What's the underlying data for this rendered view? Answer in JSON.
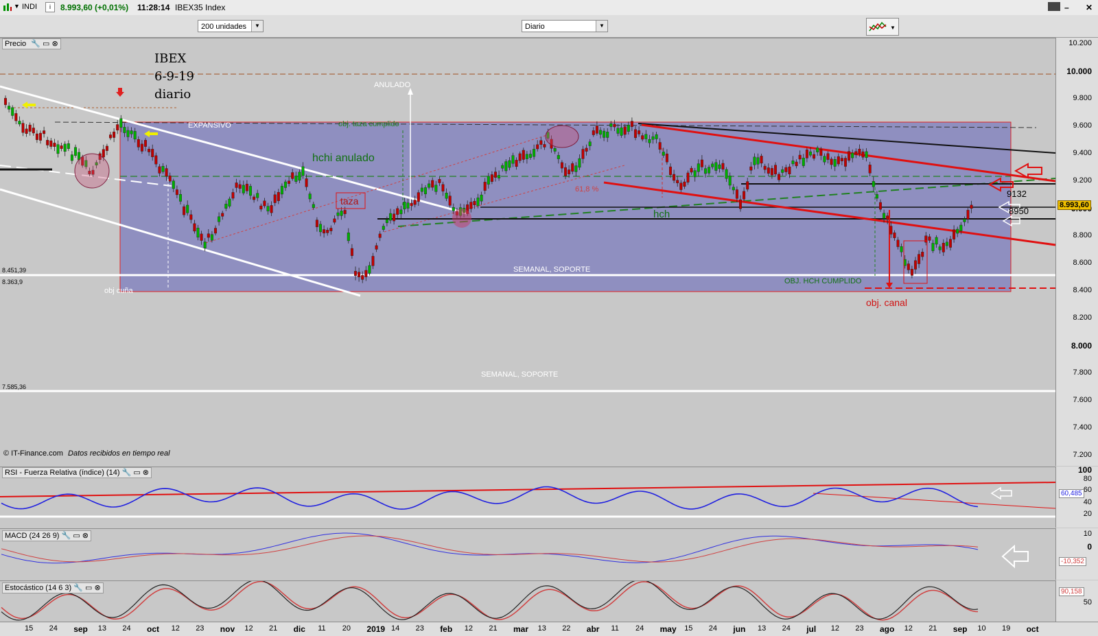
{
  "header": {
    "instrument": "INDI",
    "price": "8.993,60 (+0,01%)",
    "time": "11:28:14",
    "index_name": "IBEX35 Index"
  },
  "toolbar": {
    "units_value": "200 unidades",
    "period_value": "Diario"
  },
  "price_panel": {
    "title": "Precio",
    "chart_title": [
      "IBEX",
      "6-9-19",
      "diario"
    ],
    "annotations": {
      "expansivo": "EXPANSIVO",
      "anulado": "ANULADO",
      "obj_taza": "obj. taza cumplido",
      "hchi_anulado": "hchi anulado",
      "taza": "taza",
      "pct": "61,8 %",
      "hch": "hch",
      "semanal_1": "SEMANAL, SOPORTE",
      "semanal_2": "SEMANAL, SOPORTE",
      "obj_hch": "OBJ. HCH CUMPLIDO",
      "obj_canal": "obj. canal",
      "obj_cuna": "obj cuña",
      "level_9132": "9132",
      "level_8950": "8950",
      "lvl_left_1": "8.451,39",
      "lvl_left_2": "8.363,9",
      "lvl_left_3": "7.585,36",
      "copyright": "© IT-Finance.com",
      "realtime": "Datos recibidos en tiempo real"
    },
    "y_ticks": [
      "10.200",
      "10.000",
      "9.800",
      "9.600",
      "9.400",
      "9.200",
      "9.000",
      "8.800",
      "8.600",
      "8.400",
      "8.200",
      "8.000",
      "7.800",
      "7.600",
      "7.400",
      "7.200"
    ],
    "current_price_label": "8.993,60"
  },
  "rsi_panel": {
    "title": "RSI - Fuerza Relativa (índice) (14)",
    "y_ticks": [
      "100",
      "80",
      "60",
      "40",
      "20"
    ],
    "current": "60,485"
  },
  "macd_panel": {
    "title": "MACD (24 26 9)",
    "y_ticks": [
      "10",
      "0"
    ],
    "current": "-10,352"
  },
  "stoch_panel": {
    "title": "Estocástico (14 6 3)",
    "y_ticks": [
      "50"
    ],
    "current": "90,158"
  },
  "x_axis": [
    {
      "t": "15",
      "b": false
    },
    {
      "t": "24",
      "b": false
    },
    {
      "t": "sep",
      "b": true
    },
    {
      "t": "13",
      "b": false
    },
    {
      "t": "24",
      "b": false
    },
    {
      "t": "oct",
      "b": true
    },
    {
      "t": "12",
      "b": false
    },
    {
      "t": "23",
      "b": false
    },
    {
      "t": "nov",
      "b": true
    },
    {
      "t": "12",
      "b": false
    },
    {
      "t": "21",
      "b": false
    },
    {
      "t": "dic",
      "b": true
    },
    {
      "t": "11",
      "b": false
    },
    {
      "t": "20",
      "b": false
    },
    {
      "t": "2019",
      "b": true
    },
    {
      "t": "14",
      "b": false
    },
    {
      "t": "23",
      "b": false
    },
    {
      "t": "feb",
      "b": true
    },
    {
      "t": "12",
      "b": false
    },
    {
      "t": "21",
      "b": false
    },
    {
      "t": "mar",
      "b": true
    },
    {
      "t": "13",
      "b": false
    },
    {
      "t": "22",
      "b": false
    },
    {
      "t": "abr",
      "b": true
    },
    {
      "t": "11",
      "b": false
    },
    {
      "t": "24",
      "b": false
    },
    {
      "t": "may",
      "b": true
    },
    {
      "t": "15",
      "b": false
    },
    {
      "t": "24",
      "b": false
    },
    {
      "t": "jun",
      "b": true
    },
    {
      "t": "13",
      "b": false
    },
    {
      "t": "24",
      "b": false
    },
    {
      "t": "jul",
      "b": true
    },
    {
      "t": "12",
      "b": false
    },
    {
      "t": "23",
      "b": false
    },
    {
      "t": "ago",
      "b": true
    },
    {
      "t": "12",
      "b": false
    },
    {
      "t": "21",
      "b": false
    },
    {
      "t": "sep",
      "b": true
    },
    {
      "t": "10",
      "b": false
    },
    {
      "t": "19",
      "b": false
    },
    {
      "t": "oct",
      "b": true
    }
  ],
  "colors": {
    "box_fill": "#8f8fc0",
    "rsi_line": "#2020e0",
    "trend_red": "#e01010",
    "candle_up": "#00b000",
    "candle_down": "#c00000"
  }
}
